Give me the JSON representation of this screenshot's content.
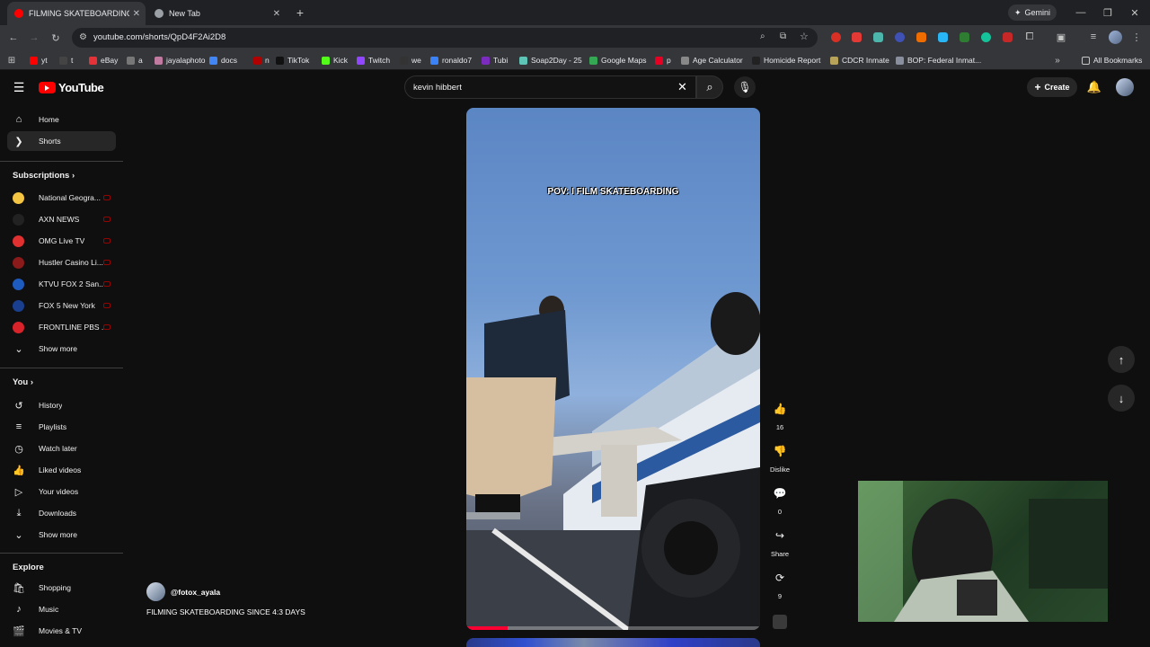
{
  "browser": {
    "tabs": [
      {
        "title": "FILMING SKATEBOARDING SINCE",
        "active": true
      },
      {
        "title": "New Tab",
        "active": false
      }
    ],
    "gemini_label": "Gemini",
    "url": "youtube.com/shorts/QpD4F2Ai2D8",
    "bookmarks": [
      {
        "label": "yt",
        "color": "#ff0000"
      },
      {
        "label": "t",
        "color": "#444444"
      },
      {
        "label": "eBay",
        "color": "#e53238"
      },
      {
        "label": "a",
        "color": "#777777"
      },
      {
        "label": "jayalaphoto",
        "color": "#c27ba0"
      },
      {
        "label": "docs",
        "color": "#4285f4"
      },
      {
        "label": "n",
        "color": "#b00000"
      },
      {
        "label": "TikTok",
        "color": "#111111"
      },
      {
        "label": "Kick",
        "color": "#53fc18"
      },
      {
        "label": "Twitch",
        "color": "#9146ff"
      },
      {
        "label": "we",
        "color": "#333333"
      },
      {
        "label": "ronaldo7",
        "color": "#3b82f6"
      },
      {
        "label": "Tubi",
        "color": "#7b2cbf"
      },
      {
        "label": "Soap2Day - 25",
        "color": "#5ec4b6"
      },
      {
        "label": "Google Maps",
        "color": "#34a853"
      },
      {
        "label": "p",
        "color": "#e60023"
      },
      {
        "label": "Age Calculator",
        "color": "#888888"
      },
      {
        "label": "Homicide Report",
        "color": "#222222"
      },
      {
        "label": "CDCR Inmate",
        "color": "#b7a35a"
      },
      {
        "label": "BOP: Federal Inmat...",
        "color": "#8a8fa0"
      }
    ],
    "all_bookmarks": "All Bookmarks"
  },
  "youtube": {
    "logo_text": "YouTube",
    "search_value": "kevin hibbert",
    "create_label": "Create",
    "sidebar": {
      "main": [
        {
          "label": "Home",
          "icon": "home-icon",
          "glyph": "⌂"
        },
        {
          "label": "Shorts",
          "icon": "shorts-icon",
          "glyph": "❯"
        }
      ],
      "subscriptions_title": "Subscriptions",
      "subscriptions": [
        {
          "label": "National Geogra...",
          "color": "#f4c542"
        },
        {
          "label": "AXN NEWS",
          "color": "#222222"
        },
        {
          "label": "OMG Live TV",
          "color": "#e03030"
        },
        {
          "label": "Hustler Casino Li...",
          "color": "#8b1a1a"
        },
        {
          "label": "KTVU FOX 2 San...",
          "color": "#1e5bbf"
        },
        {
          "label": "FOX 5 New York",
          "color": "#1a3f8f"
        },
        {
          "label": "FRONTLINE PBS ...",
          "color": "#d8232a"
        }
      ],
      "show_more_1": "Show more",
      "you_title": "You",
      "you": [
        {
          "label": "History",
          "icon": "history-icon",
          "glyph": "↺"
        },
        {
          "label": "Playlists",
          "icon": "playlists-icon",
          "glyph": "≡"
        },
        {
          "label": "Watch later",
          "icon": "watch-later-icon",
          "glyph": "◷"
        },
        {
          "label": "Liked videos",
          "icon": "liked-videos-icon",
          "glyph": "👍"
        },
        {
          "label": "Your videos",
          "icon": "your-videos-icon",
          "glyph": "▷"
        },
        {
          "label": "Downloads",
          "icon": "downloads-icon",
          "glyph": "⤓"
        }
      ],
      "show_more_2": "Show more",
      "explore_title": "Explore",
      "explore": [
        {
          "label": "Shopping",
          "icon": "shopping-icon",
          "glyph": "🛍"
        },
        {
          "label": "Music",
          "icon": "music-icon",
          "glyph": "♪"
        },
        {
          "label": "Movies & TV",
          "icon": "movies-icon",
          "glyph": "🎬"
        }
      ]
    },
    "short": {
      "overlay_text": "POV: I FILM SKATEBOARDING",
      "channel": "@fotox_ayala",
      "title": "FILMING SKATEBOARDING SINCE 4:3 DAYS",
      "progress_fraction": 0.14
    },
    "actions": {
      "likes": "16",
      "dislike": "Dislike",
      "comments": "0",
      "share": "Share",
      "remix": "9"
    }
  }
}
